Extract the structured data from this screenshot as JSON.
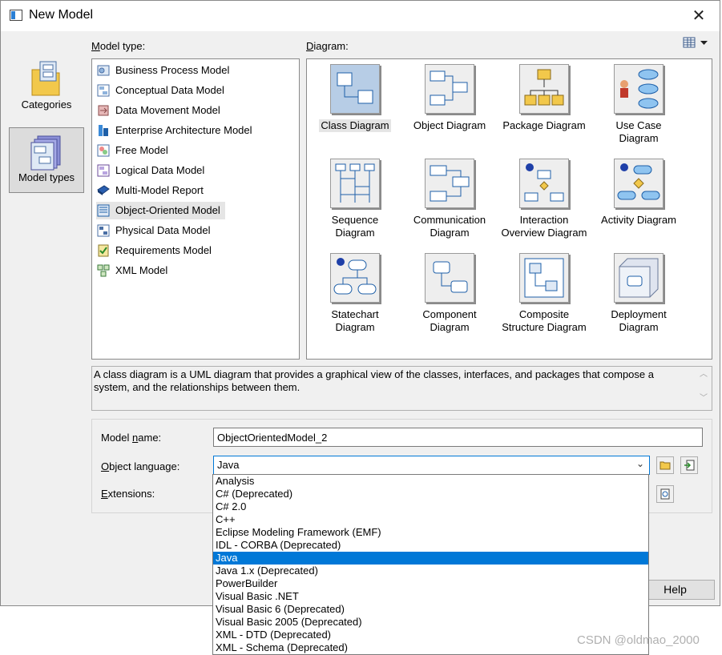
{
  "window": {
    "title": "New Model",
    "close_glyph": "✕"
  },
  "categories_panel": {
    "items": [
      {
        "label": "Categories",
        "icon": "folder-icon",
        "selected": false
      },
      {
        "label": "Model types",
        "icon": "model-types-icon",
        "selected": true
      }
    ]
  },
  "model_type": {
    "label_prefix": "M",
    "label_rest": "odel type:",
    "items": [
      {
        "label": "Business Process Model",
        "icon": "business-process-icon"
      },
      {
        "label": "Conceptual Data Model",
        "icon": "conceptual-data-icon"
      },
      {
        "label": "Data Movement Model",
        "icon": "data-movement-icon"
      },
      {
        "label": "Enterprise Architecture Model",
        "icon": "enterprise-architecture-icon"
      },
      {
        "label": "Free Model",
        "icon": "free-model-icon"
      },
      {
        "label": "Logical Data Model",
        "icon": "logical-data-icon"
      },
      {
        "label": "Multi-Model Report",
        "icon": "multi-model-report-icon"
      },
      {
        "label": "Object-Oriented Model",
        "icon": "object-oriented-icon",
        "selected": true
      },
      {
        "label": "Physical Data Model",
        "icon": "physical-data-icon"
      },
      {
        "label": "Requirements Model",
        "icon": "requirements-icon"
      },
      {
        "label": "XML Model",
        "icon": "xml-model-icon"
      }
    ]
  },
  "diagram": {
    "label_prefix": "D",
    "label_rest": "iagram:",
    "items": [
      {
        "label": "Class Diagram",
        "icon": "class-diagram-icon",
        "selected": true
      },
      {
        "label": "Object Diagram",
        "icon": "object-diagram-icon"
      },
      {
        "label": "Package Diagram",
        "icon": "package-diagram-icon"
      },
      {
        "label": "Use Case\nDiagram",
        "icon": "use-case-diagram-icon"
      },
      {
        "label": "Sequence\nDiagram",
        "icon": "sequence-diagram-icon"
      },
      {
        "label": "Communication\nDiagram",
        "icon": "communication-diagram-icon"
      },
      {
        "label": "Interaction\nOverview Diagram",
        "icon": "interaction-overview-icon"
      },
      {
        "label": "Activity Diagram",
        "icon": "activity-diagram-icon"
      },
      {
        "label": "Statechart\nDiagram",
        "icon": "statechart-diagram-icon"
      },
      {
        "label": "Component\nDiagram",
        "icon": "component-diagram-icon"
      },
      {
        "label": "Composite\nStructure Diagram",
        "icon": "composite-structure-icon"
      },
      {
        "label": "Deployment\nDiagram",
        "icon": "deployment-diagram-icon"
      }
    ]
  },
  "description": "A class diagram is a UML diagram that provides a graphical view of the classes, interfaces, and packages that compose a system, and the relationships between them.",
  "form": {
    "model_name_prefix": "Model ",
    "model_name_key": "n",
    "model_name_rest": "ame:",
    "model_name_value": "ObjectOrientedModel_2",
    "object_language_key": "O",
    "object_language_rest": "bject language:",
    "object_language_value": "Java",
    "extensions_key": "E",
    "extensions_rest": "xtensions:"
  },
  "buttons": {
    "help": "Help"
  },
  "language_options": [
    "Analysis",
    "C# (Deprecated)",
    "C# 2.0",
    "C++",
    "Eclipse Modeling Framework (EMF)",
    "IDL - CORBA (Deprecated)",
    "Java",
    "Java 1.x (Deprecated)",
    "PowerBuilder",
    "Visual Basic .NET",
    "Visual Basic 6 (Deprecated)",
    "Visual Basic 2005 (Deprecated)",
    "XML - DTD (Deprecated)",
    "XML - Schema (Deprecated)"
  ],
  "selected_language_index": 6,
  "watermark": "CSDN @oldmao_2000",
  "colors": {
    "selection": "#0078d7",
    "dialog_bg": "#f0f0f0"
  }
}
